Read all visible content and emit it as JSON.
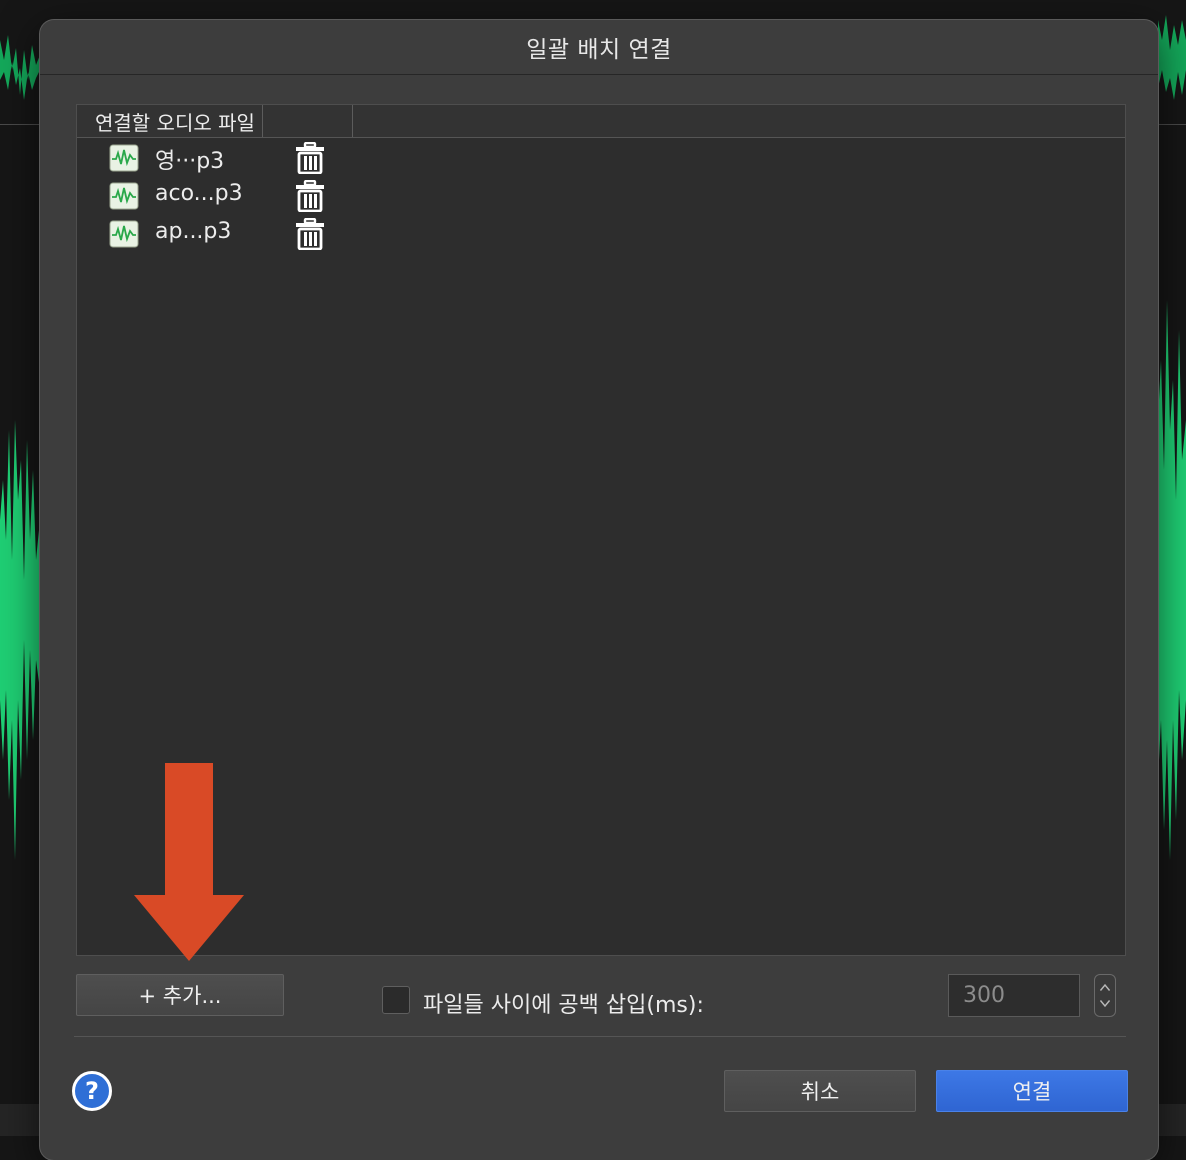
{
  "dialog": {
    "title": "일괄 배치 연결",
    "table": {
      "columns": [
        "연결할 오디오 파일",
        ""
      ],
      "files": [
        {
          "name": "영···p3"
        },
        {
          "name": "aco...p3"
        },
        {
          "name": "ap...p3"
        }
      ]
    },
    "add_button": "+ 추가...",
    "gap_checkbox": {
      "label": "파일들 사이에 공백 삽입(ms):",
      "checked": false
    },
    "gap_value": "300",
    "help_label": "?",
    "cancel_button": "취소",
    "connect_button": "연결"
  },
  "colors": {
    "accent": "#2f65d2",
    "annotation_arrow": "#d94a26",
    "waveform": "#1fcf74"
  },
  "icons": [
    "audio-file-icon",
    "trash-icon",
    "help-icon",
    "stepper-icon",
    "annotation-arrow-icon"
  ]
}
